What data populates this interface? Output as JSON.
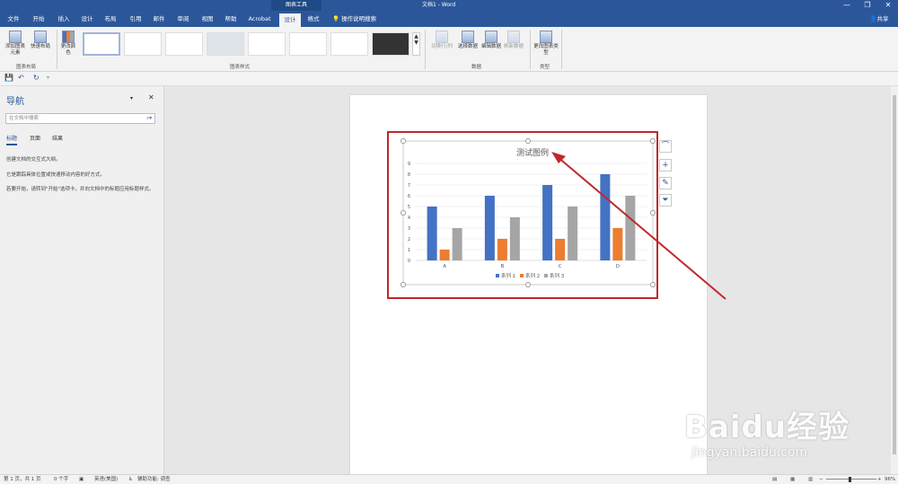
{
  "titlebar": {
    "context_title": "图表工具",
    "doc_title": "文档1 - Word",
    "minimize": "—",
    "restore": "❐",
    "close": "✕"
  },
  "tabs": [
    "文件",
    "开始",
    "插入",
    "设计",
    "布局",
    "引用",
    "邮件",
    "审阅",
    "视图",
    "帮助",
    "Acrobat",
    "设计",
    "格式"
  ],
  "tell_me": "操作说明搜索",
  "share": "共享",
  "ribbon": {
    "add_element": "添加图表元素",
    "quick_layout": "快速布局",
    "change_color": "更改颜色",
    "group_layout": "图表布局",
    "group_styles": "图表样式",
    "switch_row_col": "切换行/列",
    "select_data": "选择数据",
    "edit_data": "编辑数据",
    "refresh_data": "刷新数据",
    "group_data": "数据",
    "change_type": "更改图表类型",
    "group_type": "类型"
  },
  "nav": {
    "title": "导航",
    "search_placeholder": "在文档中搜索",
    "tabs": [
      "标题",
      "页面",
      "结果"
    ],
    "line1": "创建文档的交互式大纲。",
    "line2": "它是跟踪具体位置或快速移动内容的好方式。",
    "line3": "若要开始，请转到\"开始\"选项卡，并向文档中的标题应用标题样式。"
  },
  "status": {
    "page": "第 1 页，共 1 页",
    "words": "0 个字",
    "lang": "英语(美国)",
    "access": "辅助功能: 调查",
    "zoom": "96%"
  },
  "watermark": {
    "main": "Baidu经验",
    "sub": "jingyan.baidu.com"
  },
  "colors": {
    "accent": "#2b579a",
    "s1": "#4472c4",
    "s2": "#ed7d31",
    "s3": "#a5a5a5",
    "annot": "#c0282d"
  },
  "chart_data": {
    "type": "bar",
    "title": "测试图例",
    "categories": [
      "A",
      "B",
      "C",
      "D"
    ],
    "series": [
      {
        "name": "系列 1",
        "values": [
          5,
          6,
          7,
          8
        ]
      },
      {
        "name": "系列 2",
        "values": [
          1,
          2,
          2,
          3
        ]
      },
      {
        "name": "系列 3",
        "values": [
          3,
          4,
          5,
          6
        ]
      }
    ],
    "ylim": [
      0,
      9
    ],
    "yticks": [
      0,
      1,
      2,
      3,
      4,
      5,
      6,
      7,
      8,
      9
    ],
    "legend": "bottom",
    "grid": true
  }
}
